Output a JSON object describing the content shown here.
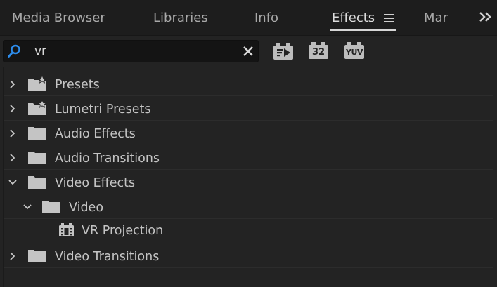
{
  "tabs": [
    {
      "label": "Media Browser",
      "active": false
    },
    {
      "label": "Libraries",
      "active": false
    },
    {
      "label": "Info",
      "active": false
    },
    {
      "label": "Effects",
      "active": true
    },
    {
      "label": "Marl",
      "active": false
    }
  ],
  "icons": {
    "panel_menu": "hamburger-menu-icon",
    "overflow": "double-chevron-right-icon",
    "search": "magnifier-icon",
    "clear": "close-icon",
    "folder": "folder-icon",
    "folder_star": "folder-star-icon",
    "effect": "film-effect-icon"
  },
  "search": {
    "value": "vr",
    "placeholder": ""
  },
  "toolbar": {
    "accelerated_label": "",
    "bit32_label": "32",
    "yuv_label": "YUV"
  },
  "tree": [
    {
      "label": "Presets",
      "icon": "folder-star-icon",
      "expanded": false
    },
    {
      "label": "Lumetri Presets",
      "icon": "folder-star-icon",
      "expanded": false
    },
    {
      "label": "Audio Effects",
      "icon": "folder-icon",
      "expanded": false
    },
    {
      "label": "Audio Transitions",
      "icon": "folder-icon",
      "expanded": false
    },
    {
      "label": "Video Effects",
      "icon": "folder-icon",
      "expanded": true
    },
    {
      "label": "Video",
      "icon": "folder-icon",
      "expanded": true
    },
    {
      "label": "VR Projection",
      "icon": "film-effect-icon",
      "expanded": false
    },
    {
      "label": "Video Transitions",
      "icon": "folder-icon",
      "expanded": false
    }
  ],
  "colors": {
    "background": "#232323",
    "tabbar": "#1d1d1d",
    "text": "#c4c4c4",
    "search_icon": "#2d8ceb",
    "badge": "#bdbdbd"
  }
}
